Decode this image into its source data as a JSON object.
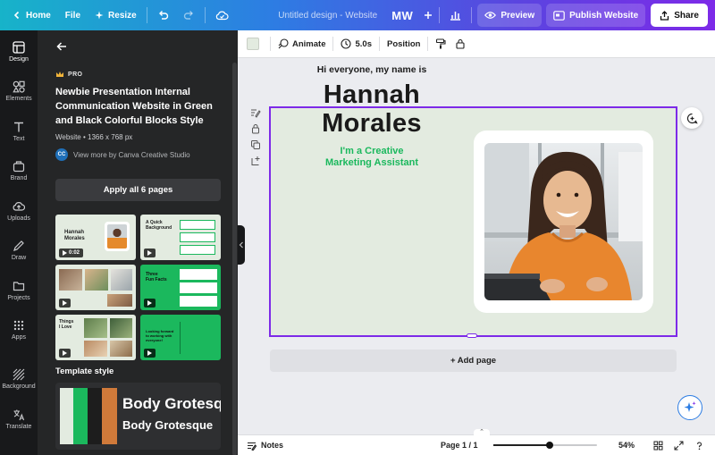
{
  "topbar": {
    "home_label": "Home",
    "file_label": "File",
    "resize_label": "Resize",
    "doc_title": "Untitled design - Website",
    "avatar_initials": "MW",
    "preview_label": "Preview",
    "publish_label": "Publish Website",
    "share_label": "Share"
  },
  "rail": {
    "items": [
      {
        "label": "Design",
        "icon": "design-icon"
      },
      {
        "label": "Elements",
        "icon": "elements-icon"
      },
      {
        "label": "Text",
        "icon": "text-icon"
      },
      {
        "label": "Brand",
        "icon": "brand-icon"
      },
      {
        "label": "Uploads",
        "icon": "uploads-icon"
      },
      {
        "label": "Draw",
        "icon": "draw-icon"
      },
      {
        "label": "Projects",
        "icon": "folder-icon"
      },
      {
        "label": "Apps",
        "icon": "apps-icon"
      },
      {
        "label": "Background",
        "icon": "background-icon"
      },
      {
        "label": "Translate",
        "icon": "translate-icon"
      }
    ]
  },
  "panel": {
    "badge": "PRO",
    "title": "Newbie Presentation Internal Communication Website in Green and Black Colorful Blocks Style",
    "meta": "Website • 1366 x 768 px",
    "author_initials": "CC",
    "author": "View more by Canva Creative Studio",
    "apply_label": "Apply all 6 pages",
    "thumbs": [
      {
        "duration": "0:02",
        "lines": [
          "Hannah",
          "Morales"
        ]
      },
      {
        "duration": "",
        "lines": [
          "A Quick",
          "Background"
        ]
      },
      {
        "duration": "",
        "lines": []
      },
      {
        "duration": "",
        "lines": [
          "Three",
          "Fun Facts"
        ]
      },
      {
        "duration": "",
        "lines": [
          "Things",
          "I Love"
        ]
      },
      {
        "duration": "",
        "lines": [
          "Looking forward",
          "to working with",
          "everyone!"
        ]
      }
    ],
    "style_heading": "Template style",
    "style_font_big": "Body Grotesque",
    "style_font_small": "Body Grotesque",
    "style_colors": [
      "#e3ebe0",
      "#1bb85d",
      "#1d1d1d",
      "#d07a3a"
    ]
  },
  "toolbar": {
    "swatch_color": "#e3ebe0",
    "animate_label": "Animate",
    "duration_label": "5.0s",
    "position_label": "Position"
  },
  "canvas": {
    "greeting": "Hi everyone, my name is",
    "name_line1": "Hannah",
    "name_line2": "Morales",
    "role_line1": "I'm a Creative",
    "role_line2": "Marketing Assistant",
    "add_page_label": "+ Add page",
    "background_color": "#e3ebe0",
    "accent_color": "#1bb85d",
    "selection_color": "#7d2ae8"
  },
  "bottombar": {
    "notes_label": "Notes",
    "page_label": "Page 1 / 1",
    "zoom_label": "54%",
    "zoom_level": 0.54
  }
}
